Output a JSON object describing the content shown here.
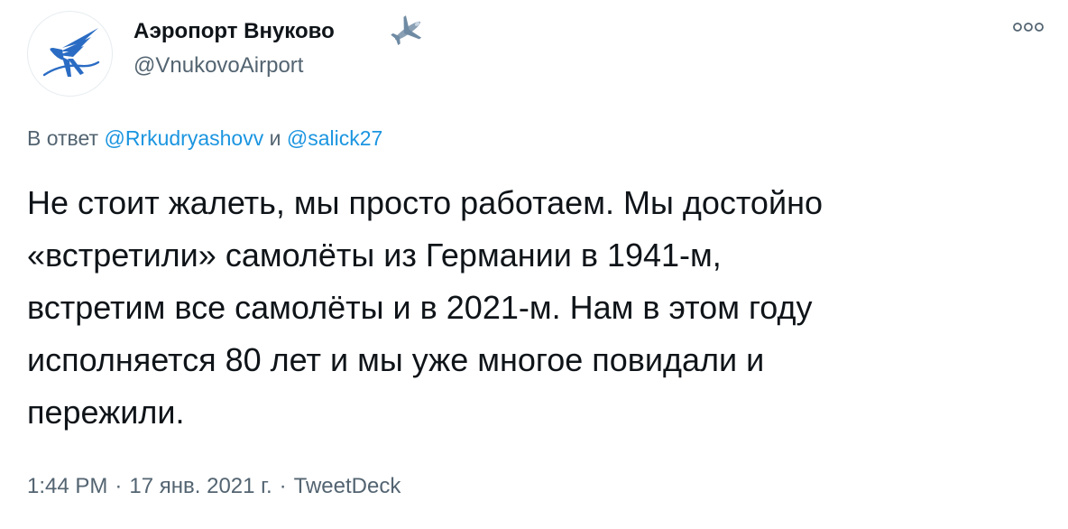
{
  "author": {
    "display_name": "Аэропорт Внуково",
    "handle": "@VnukovoAirport",
    "avatar_icon": "vnukovo-logo-icon",
    "badge_icon": "airplane-emoji-icon"
  },
  "reply": {
    "prefix": "В ответ",
    "mention_1": "@Rrkudryashovv",
    "conjunction": "и",
    "mention_2": "@salick27"
  },
  "text_lines": [
    "Не стоит жалеть, мы просто работаем. Мы достойно",
    "«встретили» самолёты из Германии в 1941-м,",
    "встретим все самолёты и в 2021-м. Нам в этом году",
    "исполняется 80 лет и мы уже многое повидали и",
    "пережили."
  ],
  "meta": {
    "time": "1:44 PM",
    "separator": "·",
    "date": "17 янв. 2021 г.",
    "source": "TweetDeck"
  },
  "colors": {
    "text": "#0f1419",
    "secondary": "#536471",
    "link": "#1b95e0",
    "logo_blue": "#2a6cc4"
  }
}
